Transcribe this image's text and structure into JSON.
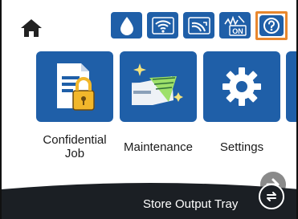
{
  "apps": [
    {
      "label": "Confidential\nJob"
    },
    {
      "label": "Maintenance"
    },
    {
      "label": "Settings"
    }
  ],
  "tray_bar": {
    "label": "Store Output Tray"
  },
  "status": {
    "ink_icon": "ink-drop-icon",
    "wifi_icon": "wifi-icon",
    "wifi_direct_icon": "wifi-direct-icon",
    "quiet_mode_icon": "quiet-mode-on-icon",
    "quiet_mode_badge": "ON",
    "help_icon": "help-icon"
  },
  "colors": {
    "tile_blue": "#1f5fa8",
    "help_highlight": "#e8872e",
    "tray_bar": "#1b1f24"
  }
}
